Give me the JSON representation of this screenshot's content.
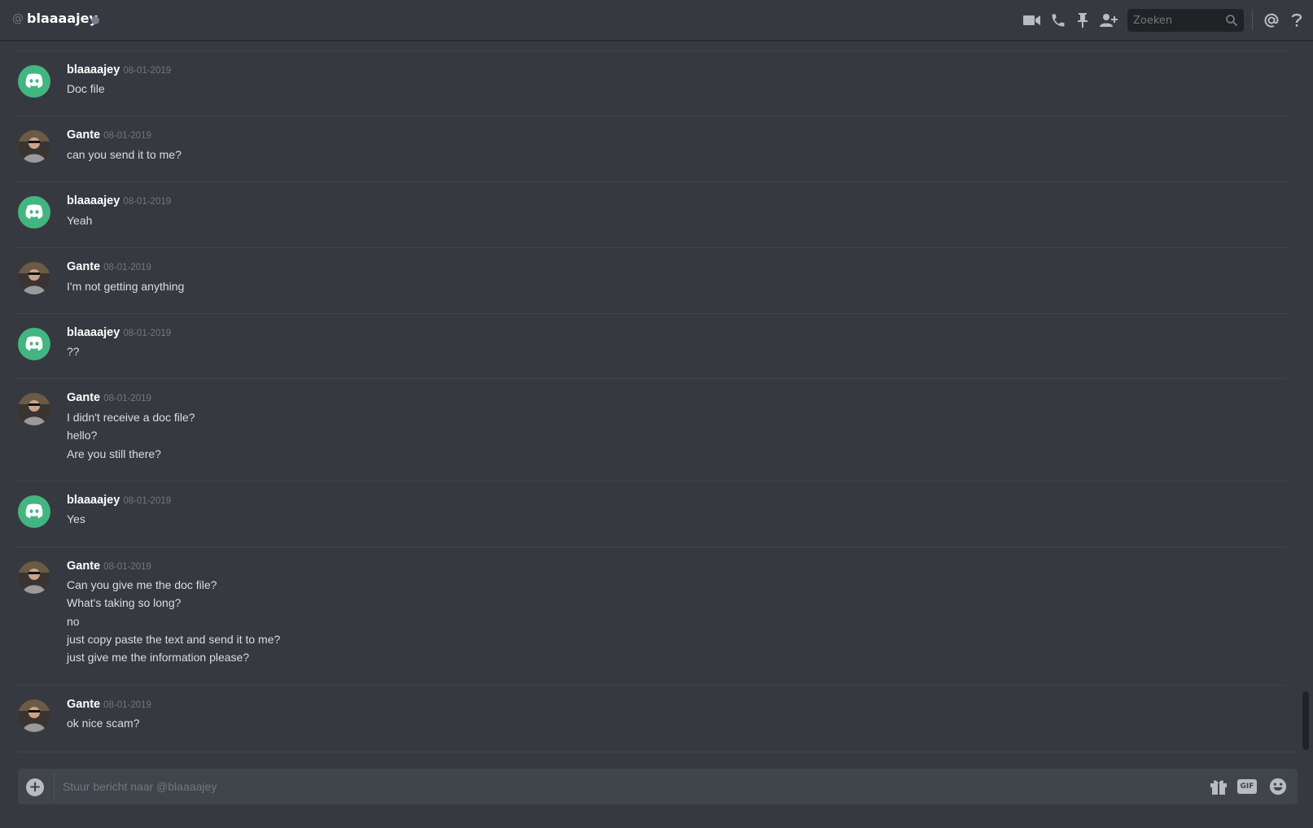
{
  "header": {
    "at_symbol": "@",
    "channel_name": "blaaaajey",
    "status": "offline",
    "search_placeholder": "Zoeken",
    "icons": [
      "video-call-icon",
      "voice-call-icon",
      "pin-icon",
      "add-friend-icon",
      "search-icon",
      "mentions-icon",
      "help-icon"
    ]
  },
  "messages": [
    {
      "author": "blaaaajey",
      "avatar": "discord-default-avatar",
      "timestamp": "08-01-2019",
      "lines": [
        "Doc file"
      ]
    },
    {
      "author": "Gante",
      "avatar": "user-photo-avatar",
      "timestamp": "08-01-2019",
      "lines": [
        "can you send it to me?"
      ]
    },
    {
      "author": "blaaaajey",
      "avatar": "discord-default-avatar",
      "timestamp": "08-01-2019",
      "lines": [
        "Yeah"
      ]
    },
    {
      "author": "Gante",
      "avatar": "user-photo-avatar",
      "timestamp": "08-01-2019",
      "lines": [
        "I'm not getting anything"
      ]
    },
    {
      "author": "blaaaajey",
      "avatar": "discord-default-avatar",
      "timestamp": "08-01-2019",
      "lines": [
        "??"
      ]
    },
    {
      "author": "Gante",
      "avatar": "user-photo-avatar",
      "timestamp": "08-01-2019",
      "lines": [
        "I didn't receive a doc file?",
        "hello?",
        "Are you still there?"
      ]
    },
    {
      "author": "blaaaajey",
      "avatar": "discord-default-avatar",
      "timestamp": "08-01-2019",
      "lines": [
        "Yes"
      ]
    },
    {
      "author": "Gante",
      "avatar": "user-photo-avatar",
      "timestamp": "08-01-2019",
      "lines": [
        "Can you give me the doc file?",
        "What's taking so long?",
        "no",
        "just copy paste the text and send it to me?",
        "just give me the information please?"
      ]
    },
    {
      "author": "Gante",
      "avatar": "user-photo-avatar",
      "timestamp": "08-01-2019",
      "lines": [
        "ok nice scam?"
      ]
    }
  ],
  "composer": {
    "placeholder": "Stuur bericht naar @blaaaajey",
    "gif_label": "GIF",
    "icons": [
      "upload-icon",
      "gift-icon",
      "gif-icon",
      "emoji-icon"
    ]
  },
  "colors": {
    "background": "#36393f",
    "discord_green": "#43b581",
    "username": "#ffffff",
    "timestamp": "#72767d",
    "message_text": "#dcddde"
  }
}
